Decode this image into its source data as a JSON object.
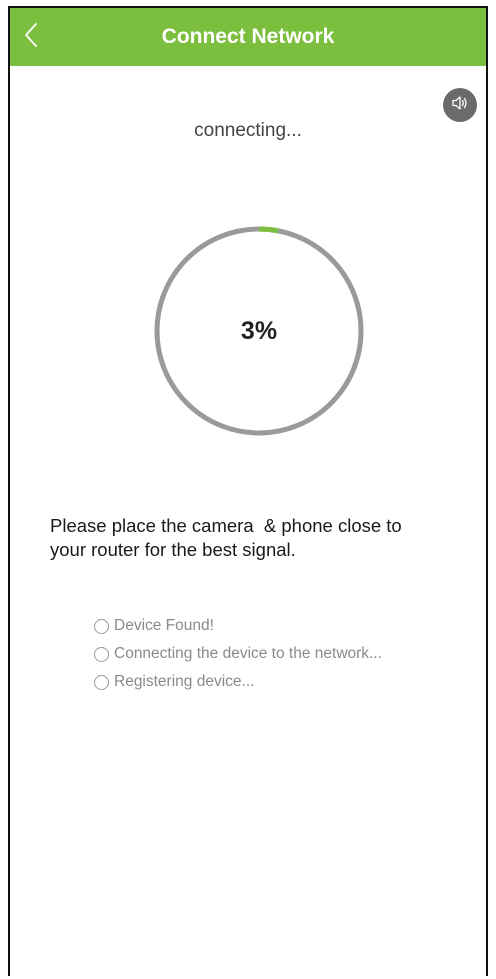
{
  "header": {
    "title": "Connect Network",
    "background_color": "#7cbf3f",
    "back_icon": "chevron-left-icon"
  },
  "sound": {
    "icon": "speaker-icon"
  },
  "status": {
    "text": "connecting..."
  },
  "progress": {
    "label": "3%",
    "value_percent": 3,
    "track_color": "#9a9a9a",
    "fill_color": "#7cbf3f"
  },
  "instruction": {
    "line1": "Please place the camera  & phone close to",
    "line2": "your router for the best signal."
  },
  "steps": [
    {
      "label": "Device Found!"
    },
    {
      "label": "Connecting the device to the network..."
    },
    {
      "label": "Registering device..."
    }
  ]
}
